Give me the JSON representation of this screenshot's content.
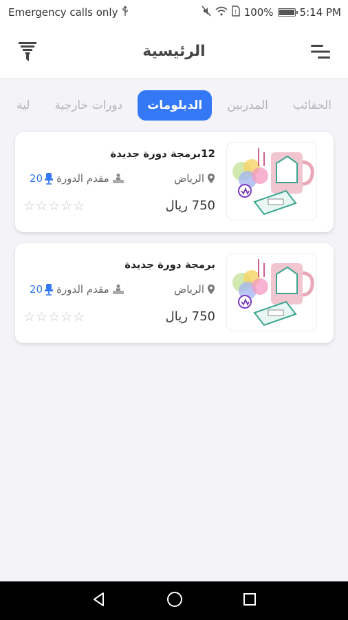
{
  "status_bar": {
    "left_text": "Emergency calls only",
    "battery_percent": 100,
    "battery_text": "100%",
    "time": "5:14 PM"
  },
  "header": {
    "title": "الرئيسية",
    "filter_icon": "filter-icon",
    "menu_icon": "menu-icon"
  },
  "tabs": [
    {
      "label": "لية",
      "active": false
    },
    {
      "label": "دورات خارجية",
      "active": false
    },
    {
      "label": "الدبلومات",
      "active": true
    },
    {
      "label": "المدربين",
      "active": false
    },
    {
      "label": "الحقائب",
      "active": false
    }
  ],
  "courses": [
    {
      "title": "12برمجة دورة جديدة",
      "location": "الرياض",
      "presenter": "مقدم الدورة",
      "seats": "20",
      "price": "750 ريال",
      "rating": 0,
      "max_rating": 5
    },
    {
      "title": "برمجة دورة جديدة",
      "location": "الرياض",
      "presenter": "مقدم الدورة",
      "seats": "20",
      "price": "750 ريال",
      "rating": 0,
      "max_rating": 5
    }
  ],
  "colors": {
    "accent": "#3478f6",
    "inactive_tab": "#b4b4bc",
    "background": "#f4f4f8"
  },
  "nav": {
    "back_icon": "back-icon",
    "home_icon": "home-icon",
    "recents_icon": "recents-icon"
  }
}
